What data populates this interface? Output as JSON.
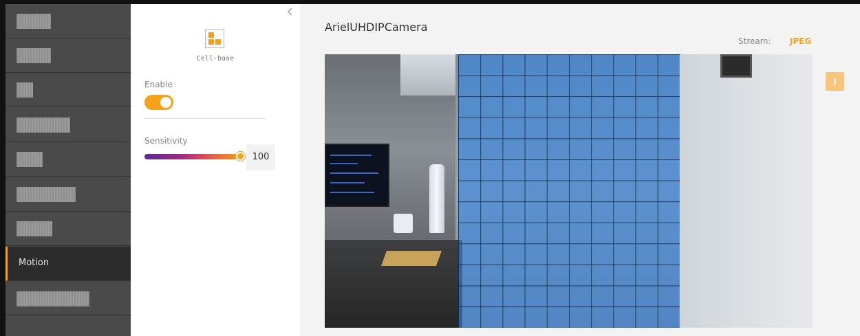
{
  "sidebar": {
    "items": [
      {
        "label": "",
        "redacted": true
      },
      {
        "label": "",
        "redacted": true
      },
      {
        "label": "",
        "redacted": true
      },
      {
        "label": "",
        "redacted": true
      },
      {
        "label": "",
        "redacted": true
      },
      {
        "label": "",
        "redacted": true
      },
      {
        "label": "",
        "redacted": true
      },
      {
        "label": "Motion",
        "active": true
      },
      {
        "label": "",
        "redacted": true
      }
    ]
  },
  "panel": {
    "collapse_icon": "chevron-left-icon",
    "mode_icon": "cell-grid-icon",
    "mode_label": "Cell-base",
    "enable_label": "Enable",
    "enable_value": true,
    "sensitivity_label": "Sensitivity",
    "sensitivity_value": "100",
    "sensitivity_level": 1.0
  },
  "main": {
    "camera_title": "ArielUHDIPCamera",
    "stream_label": "Stream:",
    "stream_value": "JPEG",
    "stream_badge": "J"
  },
  "colors": {
    "accent": "#f5a11a",
    "sidebar_bg": "#4a4a4a",
    "sidebar_active_bg": "#2c2c2c",
    "overlay": "#3684e0"
  }
}
